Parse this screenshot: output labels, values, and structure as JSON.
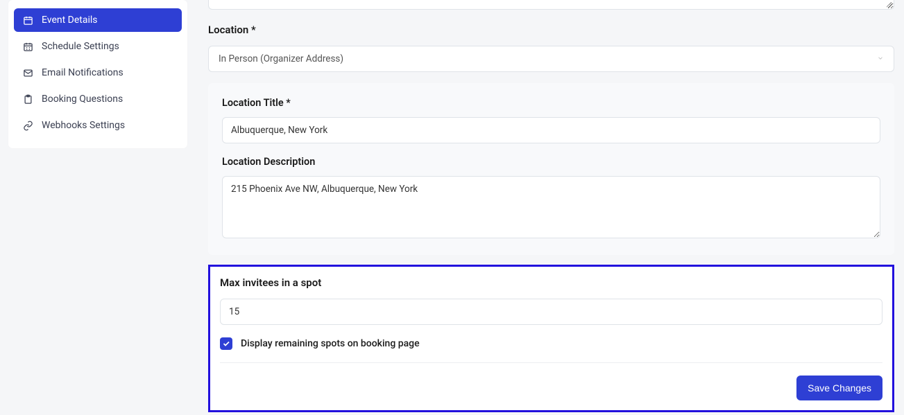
{
  "sidebar": {
    "items": [
      {
        "label": "Event Details"
      },
      {
        "label": "Schedule Settings"
      },
      {
        "label": "Email Notifications"
      },
      {
        "label": "Booking Questions"
      },
      {
        "label": "Webhooks Settings"
      }
    ]
  },
  "form": {
    "location_label": "Location *",
    "location_select_value": "In Person (Organizer Address)",
    "location_title_label": "Location Title *",
    "location_title_value": "Albuquerque, New York",
    "location_description_label": "Location Description",
    "location_description_value": "215 Phoenix Ave NW, Albuquerque, New York",
    "max_invitees_label": "Max invitees in a spot",
    "max_invitees_value": "15",
    "display_remaining_label": "Display remaining spots on booking page",
    "display_remaining_checked": true,
    "save_button_label": "Save Changes"
  }
}
